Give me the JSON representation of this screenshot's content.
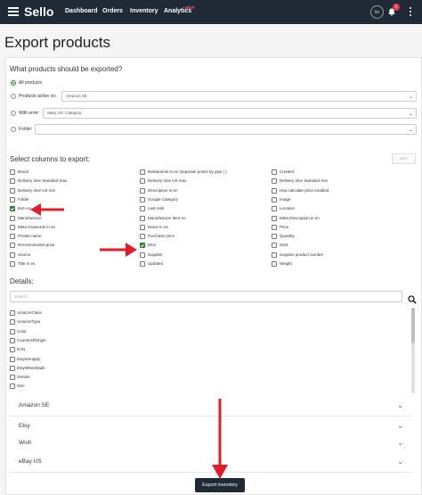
{
  "nav": {
    "logo": "Sello",
    "links": [
      "Dashboard",
      "Orders",
      "Inventory",
      "Analytics"
    ],
    "analytics_badge": "NEW",
    "avatar_text": "fils",
    "notification_count": "1"
  },
  "page": {
    "title": "Export products"
  },
  "what": {
    "heading": "What products should be exported?",
    "options": [
      {
        "label": "All products",
        "checked": true
      },
      {
        "label": "Products active on:",
        "select": "Amazon SE"
      },
      {
        "label": "With error:",
        "select": "eBay US: Category"
      },
      {
        "label": "Folder:",
        "select": ""
      }
    ]
  },
  "columns": {
    "heading": "Select columns to export:",
    "skip_label": "SKIP",
    "col1": [
      {
        "label": "Brand",
        "checked": false
      },
      {
        "label": "Delivery time Standard max",
        "checked": false
      },
      {
        "label": "Delivery time US min",
        "checked": false
      },
      {
        "label": "Folder",
        "checked": false
      },
      {
        "label": "Item no",
        "checked": true
      },
      {
        "label": "Manufacturer",
        "checked": false
      },
      {
        "label": "Meta Keywords in en",
        "checked": false
      },
      {
        "label": "Private name",
        "checked": false
      },
      {
        "label": "Recommended price",
        "checked": false
      },
      {
        "label": "Source",
        "checked": false
      },
      {
        "label": "Title in en",
        "checked": false
      }
    ],
    "col2": [
      {
        "label": "Bulletpoints in en (separate points by pipe | )",
        "checked": false
      },
      {
        "label": "Delivery time US max",
        "checked": false
      },
      {
        "label": "Description in en",
        "checked": false
      },
      {
        "label": "Google Category",
        "checked": false
      },
      {
        "label": "Last sold",
        "checked": false
      },
      {
        "label": "Manufacturer item no",
        "checked": false
      },
      {
        "label": "Name in en",
        "checked": false
      },
      {
        "label": "Purchase price",
        "checked": false
      },
      {
        "label": "SKU",
        "checked": true
      },
      {
        "label": "Supplier",
        "checked": false
      },
      {
        "label": "Updated",
        "checked": false
      }
    ],
    "col3": [
      {
        "label": "Created",
        "checked": false
      },
      {
        "label": "Delivery time Standard min",
        "checked": false
      },
      {
        "label": "Has calculate price enabled",
        "checked": false
      },
      {
        "label": "Image",
        "checked": false
      },
      {
        "label": "Location",
        "checked": false
      },
      {
        "label": "Meta Description in en",
        "checked": false
      },
      {
        "label": "Price",
        "checked": false
      },
      {
        "label": "Quantity",
        "checked": false
      },
      {
        "label": "Sold",
        "checked": false
      },
      {
        "label": "Supplier product number",
        "checked": false
      },
      {
        "label": "Weight",
        "checked": false
      }
    ]
  },
  "details": {
    "heading": "Details:",
    "search_placeholder": "Search",
    "items": [
      "AmazonClass",
      "AmazonType",
      "Color",
      "CountryOfOrigin",
      "EAN",
      "EtsyIsSupply",
      "EtsyWhenMade",
      "Gender",
      "Size"
    ]
  },
  "accordions": [
    "Amazon SE",
    "Etsy",
    "Wish",
    "eBay US"
  ],
  "export_button": "Export inventory",
  "colors": {
    "navbar": "#1f2a36",
    "checked": "#2e7d32",
    "arrow": "#e11d2a"
  }
}
